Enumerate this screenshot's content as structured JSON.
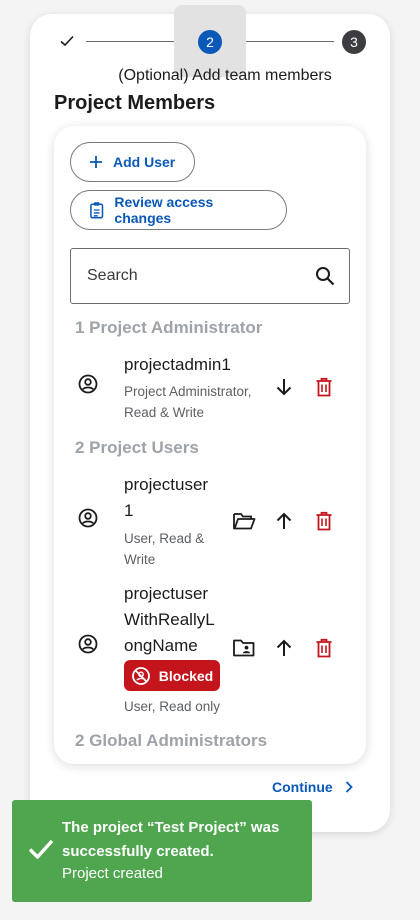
{
  "stepper": {
    "step2_number": "2",
    "step3_number": "3",
    "caption": "(Optional) Add team members",
    "active_color": "#0a58b8"
  },
  "section_title": "Project Members",
  "buttons": {
    "add_user": "Add User",
    "review_access": "Review access changes"
  },
  "search": {
    "placeholder": "Search"
  },
  "groups": {
    "admins_title": "1 Project Administrator",
    "users_title": "2 Project Users",
    "global_title": "2 Global Administrators"
  },
  "members": [
    {
      "name_lines": [
        "projectadmin1"
      ],
      "meta_lines": [
        "Project Administrator,",
        "Read & Write"
      ]
    },
    {
      "name_lines": [
        "projectuser",
        "1"
      ],
      "meta_lines": [
        "User, Read &",
        "Write"
      ]
    },
    {
      "name_lines": [
        "projectuser",
        "WithReallyL",
        "ongName"
      ],
      "badge": "Blocked",
      "meta_lines": [
        "User, Read only"
      ]
    }
  ],
  "continue_label": "Continue",
  "toast": {
    "title": "The project “Test Project” was successfully created.",
    "subtitle": "Project created",
    "color": "#4fa64f"
  },
  "colors": {
    "danger": "#c4151c",
    "muted_heading": "#9ea3a9"
  }
}
